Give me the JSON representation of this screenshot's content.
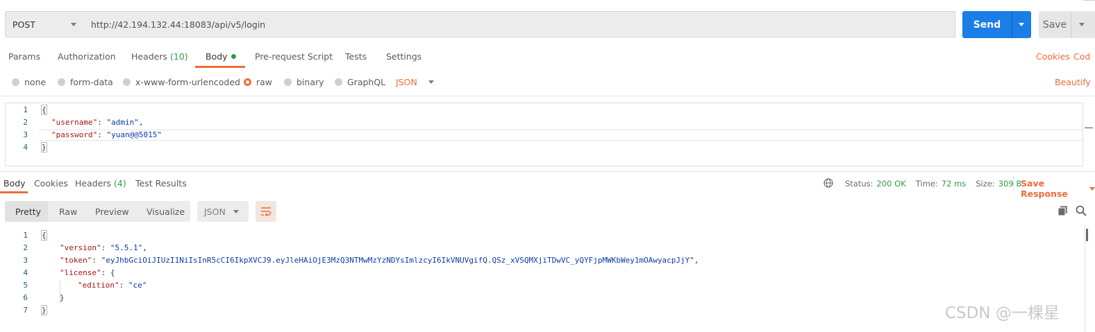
{
  "request": {
    "method": "POST",
    "url": "http://42.194.132.44:18083/api/v5/login",
    "send_label": "Send",
    "save_label": "Save"
  },
  "request_tabs": {
    "params": "Params",
    "authorization": "Authorization",
    "headers": "Headers",
    "headers_count": "(10)",
    "body": "Body",
    "pre_request": "Pre-request Script",
    "tests": "Tests",
    "settings": "Settings",
    "cookies": "Cookies",
    "code": "Cod"
  },
  "body_types": {
    "none": "none",
    "form_data": "form-data",
    "urlencoded": "x-www-form-urlencoded",
    "raw": "raw",
    "binary": "binary",
    "graphql": "GraphQL",
    "format": "JSON",
    "beautify": "Beautify",
    "selected": "raw"
  },
  "request_body": {
    "line_numbers": [
      "1",
      "2",
      "3",
      "4"
    ],
    "open": "{",
    "close": "}",
    "username_key": "\"username\"",
    "username_value": "\"admin\"",
    "password_key": "\"password\"",
    "password_value": "\"yuan@@5015\""
  },
  "response_tabs": {
    "body": "Body",
    "cookies": "Cookies",
    "headers": "Headers",
    "headers_count": "(4)",
    "test_results": "Test Results"
  },
  "response_status": {
    "status_label": "Status:",
    "status_value": "200 OK",
    "time_label": "Time:",
    "time_value": "72 ms",
    "size_label": "Size:",
    "size_value": "309 B",
    "save_response": "Save Response"
  },
  "view_modes": {
    "pretty": "Pretty",
    "raw": "Raw",
    "preview": "Preview",
    "visualize": "Visualize",
    "format": "JSON",
    "active": "Pretty"
  },
  "response_body": {
    "line_numbers": [
      "1",
      "2",
      "3",
      "4",
      "5",
      "6",
      "7"
    ],
    "open": "{",
    "close": "}",
    "version_key": "\"version\"",
    "version_value": "\"5.5.1\"",
    "token_key": "\"token\"",
    "token_value": "\"eyJhbGciOiJIUzI1NiIsInR5cCI6IkpXVCJ9.eyJleHAiOjE3MzQ3NTMwMzYzNDYsImlzcyI6IkVNUVgifQ.QSz_xVSQMXjiTDwVC_yQYFjpMWKbWey1mOAwyacpJjY\"",
    "license_key": "\"license\"",
    "license_open": "{",
    "edition_key": "\"edition\"",
    "edition_value": "\"ce\"",
    "license_close": "}"
  },
  "watermark": "CSDN @一棵星",
  "colors": {
    "accent": "#f26b3a",
    "send": "#1a7ee6",
    "success": "#2e9e48",
    "json_key": "#a31515",
    "json_string": "#0b3aa6"
  }
}
